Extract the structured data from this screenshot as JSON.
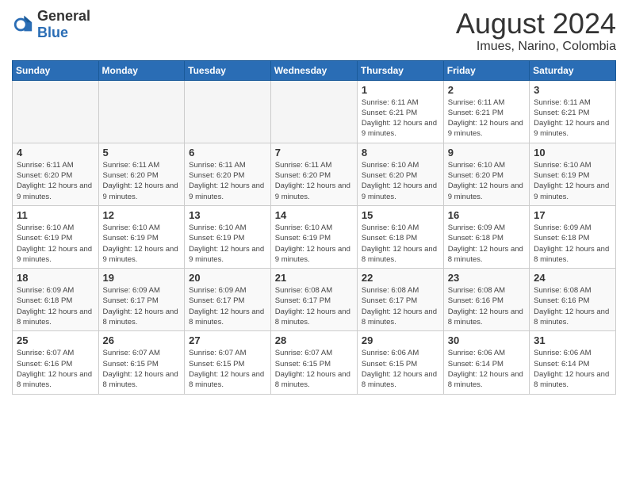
{
  "logo": {
    "text_general": "General",
    "text_blue": "Blue"
  },
  "title": {
    "month_year": "August 2024",
    "location": "Imues, Narino, Colombia"
  },
  "weekdays": [
    "Sunday",
    "Monday",
    "Tuesday",
    "Wednesday",
    "Thursday",
    "Friday",
    "Saturday"
  ],
  "weeks": [
    [
      {
        "day": "",
        "empty": true
      },
      {
        "day": "",
        "empty": true
      },
      {
        "day": "",
        "empty": true
      },
      {
        "day": "",
        "empty": true
      },
      {
        "day": "1",
        "sunrise": "6:11 AM",
        "sunset": "6:21 PM",
        "daylight": "12 hours and 9 minutes."
      },
      {
        "day": "2",
        "sunrise": "6:11 AM",
        "sunset": "6:21 PM",
        "daylight": "12 hours and 9 minutes."
      },
      {
        "day": "3",
        "sunrise": "6:11 AM",
        "sunset": "6:21 PM",
        "daylight": "12 hours and 9 minutes."
      }
    ],
    [
      {
        "day": "4",
        "sunrise": "6:11 AM",
        "sunset": "6:20 PM",
        "daylight": "12 hours and 9 minutes."
      },
      {
        "day": "5",
        "sunrise": "6:11 AM",
        "sunset": "6:20 PM",
        "daylight": "12 hours and 9 minutes."
      },
      {
        "day": "6",
        "sunrise": "6:11 AM",
        "sunset": "6:20 PM",
        "daylight": "12 hours and 9 minutes."
      },
      {
        "day": "7",
        "sunrise": "6:11 AM",
        "sunset": "6:20 PM",
        "daylight": "12 hours and 9 minutes."
      },
      {
        "day": "8",
        "sunrise": "6:10 AM",
        "sunset": "6:20 PM",
        "daylight": "12 hours and 9 minutes."
      },
      {
        "day": "9",
        "sunrise": "6:10 AM",
        "sunset": "6:20 PM",
        "daylight": "12 hours and 9 minutes."
      },
      {
        "day": "10",
        "sunrise": "6:10 AM",
        "sunset": "6:19 PM",
        "daylight": "12 hours and 9 minutes."
      }
    ],
    [
      {
        "day": "11",
        "sunrise": "6:10 AM",
        "sunset": "6:19 PM",
        "daylight": "12 hours and 9 minutes."
      },
      {
        "day": "12",
        "sunrise": "6:10 AM",
        "sunset": "6:19 PM",
        "daylight": "12 hours and 9 minutes."
      },
      {
        "day": "13",
        "sunrise": "6:10 AM",
        "sunset": "6:19 PM",
        "daylight": "12 hours and 9 minutes."
      },
      {
        "day": "14",
        "sunrise": "6:10 AM",
        "sunset": "6:19 PM",
        "daylight": "12 hours and 9 minutes."
      },
      {
        "day": "15",
        "sunrise": "6:10 AM",
        "sunset": "6:18 PM",
        "daylight": "12 hours and 8 minutes."
      },
      {
        "day": "16",
        "sunrise": "6:09 AM",
        "sunset": "6:18 PM",
        "daylight": "12 hours and 8 minutes."
      },
      {
        "day": "17",
        "sunrise": "6:09 AM",
        "sunset": "6:18 PM",
        "daylight": "12 hours and 8 minutes."
      }
    ],
    [
      {
        "day": "18",
        "sunrise": "6:09 AM",
        "sunset": "6:18 PM",
        "daylight": "12 hours and 8 minutes."
      },
      {
        "day": "19",
        "sunrise": "6:09 AM",
        "sunset": "6:17 PM",
        "daylight": "12 hours and 8 minutes."
      },
      {
        "day": "20",
        "sunrise": "6:09 AM",
        "sunset": "6:17 PM",
        "daylight": "12 hours and 8 minutes."
      },
      {
        "day": "21",
        "sunrise": "6:08 AM",
        "sunset": "6:17 PM",
        "daylight": "12 hours and 8 minutes."
      },
      {
        "day": "22",
        "sunrise": "6:08 AM",
        "sunset": "6:17 PM",
        "daylight": "12 hours and 8 minutes."
      },
      {
        "day": "23",
        "sunrise": "6:08 AM",
        "sunset": "6:16 PM",
        "daylight": "12 hours and 8 minutes."
      },
      {
        "day": "24",
        "sunrise": "6:08 AM",
        "sunset": "6:16 PM",
        "daylight": "12 hours and 8 minutes."
      }
    ],
    [
      {
        "day": "25",
        "sunrise": "6:07 AM",
        "sunset": "6:16 PM",
        "daylight": "12 hours and 8 minutes."
      },
      {
        "day": "26",
        "sunrise": "6:07 AM",
        "sunset": "6:15 PM",
        "daylight": "12 hours and 8 minutes."
      },
      {
        "day": "27",
        "sunrise": "6:07 AM",
        "sunset": "6:15 PM",
        "daylight": "12 hours and 8 minutes."
      },
      {
        "day": "28",
        "sunrise": "6:07 AM",
        "sunset": "6:15 PM",
        "daylight": "12 hours and 8 minutes."
      },
      {
        "day": "29",
        "sunrise": "6:06 AM",
        "sunset": "6:15 PM",
        "daylight": "12 hours and 8 minutes."
      },
      {
        "day": "30",
        "sunrise": "6:06 AM",
        "sunset": "6:14 PM",
        "daylight": "12 hours and 8 minutes."
      },
      {
        "day": "31",
        "sunrise": "6:06 AM",
        "sunset": "6:14 PM",
        "daylight": "12 hours and 8 minutes."
      }
    ]
  ]
}
